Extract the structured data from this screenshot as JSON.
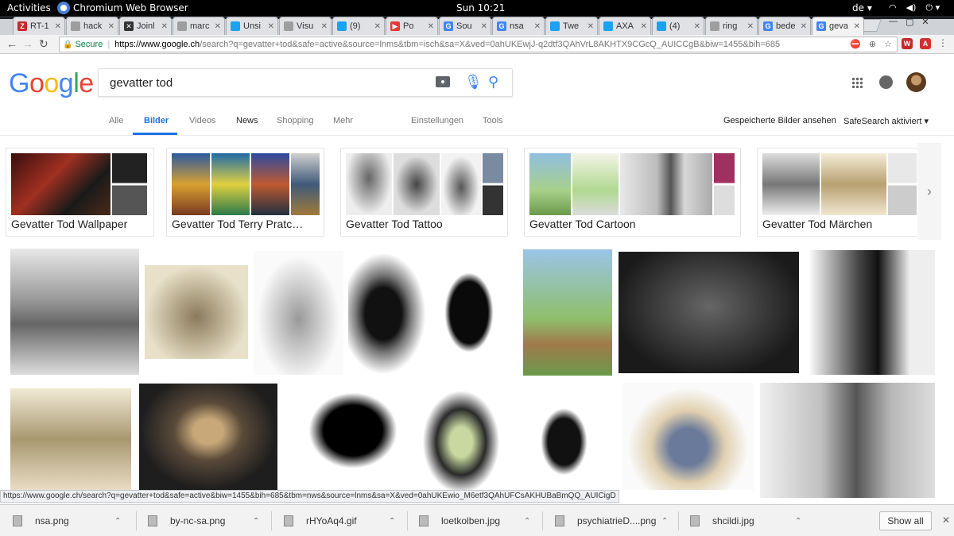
{
  "topbar": {
    "activities": "Activities",
    "app_name": "Chromium Web Browser",
    "clock": "Sun 10:21",
    "keyboard_layout": "de"
  },
  "browser_tabs": [
    {
      "label": "RT-1",
      "fav_color": "#c62828",
      "fav_text": "Z"
    },
    {
      "label": "hack",
      "fav_color": "#9e9e9e",
      "fav_text": ""
    },
    {
      "label": "Joinl",
      "fav_color": "#333333",
      "fav_text": "✕"
    },
    {
      "label": "marc",
      "fav_color": "#9e9e9e",
      "fav_text": ""
    },
    {
      "label": "Unsi",
      "fav_color": "#1da1f2",
      "fav_text": ""
    },
    {
      "label": "Visu",
      "fav_color": "#9e9e9e",
      "fav_text": ""
    },
    {
      "label": "(9)",
      "fav_color": "#1da1f2",
      "fav_text": ""
    },
    {
      "label": "Po",
      "fav_color": "#e53935",
      "fav_text": "▶"
    },
    {
      "label": "Sou",
      "fav_color": "#4285f4",
      "fav_text": "G"
    },
    {
      "label": "nsa",
      "fav_color": "#4285f4",
      "fav_text": "G"
    },
    {
      "label": "Twe",
      "fav_color": "#1da1f2",
      "fav_text": ""
    },
    {
      "label": "AXA",
      "fav_color": "#1da1f2",
      "fav_text": ""
    },
    {
      "label": "(4)",
      "fav_color": "#1da1f2",
      "fav_text": ""
    },
    {
      "label": "ring",
      "fav_color": "#9e9e9e",
      "fav_text": ""
    },
    {
      "label": "bede",
      "fav_color": "#4285f4",
      "fav_text": "G"
    },
    {
      "label": "geva",
      "fav_color": "#4285f4",
      "fav_text": "G",
      "active": true
    }
  ],
  "omnibox": {
    "secure_label": "Secure",
    "url_host": "https://www.google.ch",
    "url_rest": "/search?q=gevatter+tod&safe=active&source=lnms&tbm=isch&sa=X&ved=0ahUKEwjJ-q2dtf3QAhVrL8AKHTX9CGcQ_AUICCgB&biw=1455&bih=685"
  },
  "google": {
    "logo_letters": [
      "G",
      "o",
      "o",
      "g",
      "l",
      "e"
    ],
    "logo_colors": [
      "#4285f4",
      "#ea4335",
      "#fbbc05",
      "#4285f4",
      "#34a853",
      "#ea4335"
    ],
    "query": "gevatter tod"
  },
  "search_tabs": {
    "alle": "Alle",
    "bilder": "Bilder",
    "videos": "Videos",
    "news": "News",
    "shopping": "Shopping",
    "mehr": "Mehr",
    "einstellungen": "Einstellungen",
    "tools": "Tools",
    "saved_images": "Gespeicherte Bilder ansehen",
    "safesearch": "SafeSearch aktiviert"
  },
  "related_searches": [
    {
      "label": "Gevatter Tod Wallpaper"
    },
    {
      "label": "Gevatter Tod Terry Pratc…"
    },
    {
      "label": "Gevatter Tod Tattoo"
    },
    {
      "label": "Gevatter Tod Cartoon"
    },
    {
      "label": "Gevatter Tod Märchen"
    }
  ],
  "status_url": "https://www.google.ch/search?q=gevatter+tod&safe=active&biw=1455&bih=685&tbm=nws&source=lnms&sa=X&ved=0ahUKEwio_M6etf3QAhUFCsAKHUBaBmQQ_AUICigD",
  "downloads": [
    {
      "name": "nsa.png"
    },
    {
      "name": "by-nc-sa.png"
    },
    {
      "name": "rHYoAq4.gif"
    },
    {
      "name": "loetkolben.jpg"
    },
    {
      "name": "psychiatrieD....png"
    },
    {
      "name": "shcildi.jpg"
    }
  ],
  "show_all": "Show all",
  "colors": {
    "accent_blue": "#1a73e8",
    "secure_green": "#0b8043"
  }
}
